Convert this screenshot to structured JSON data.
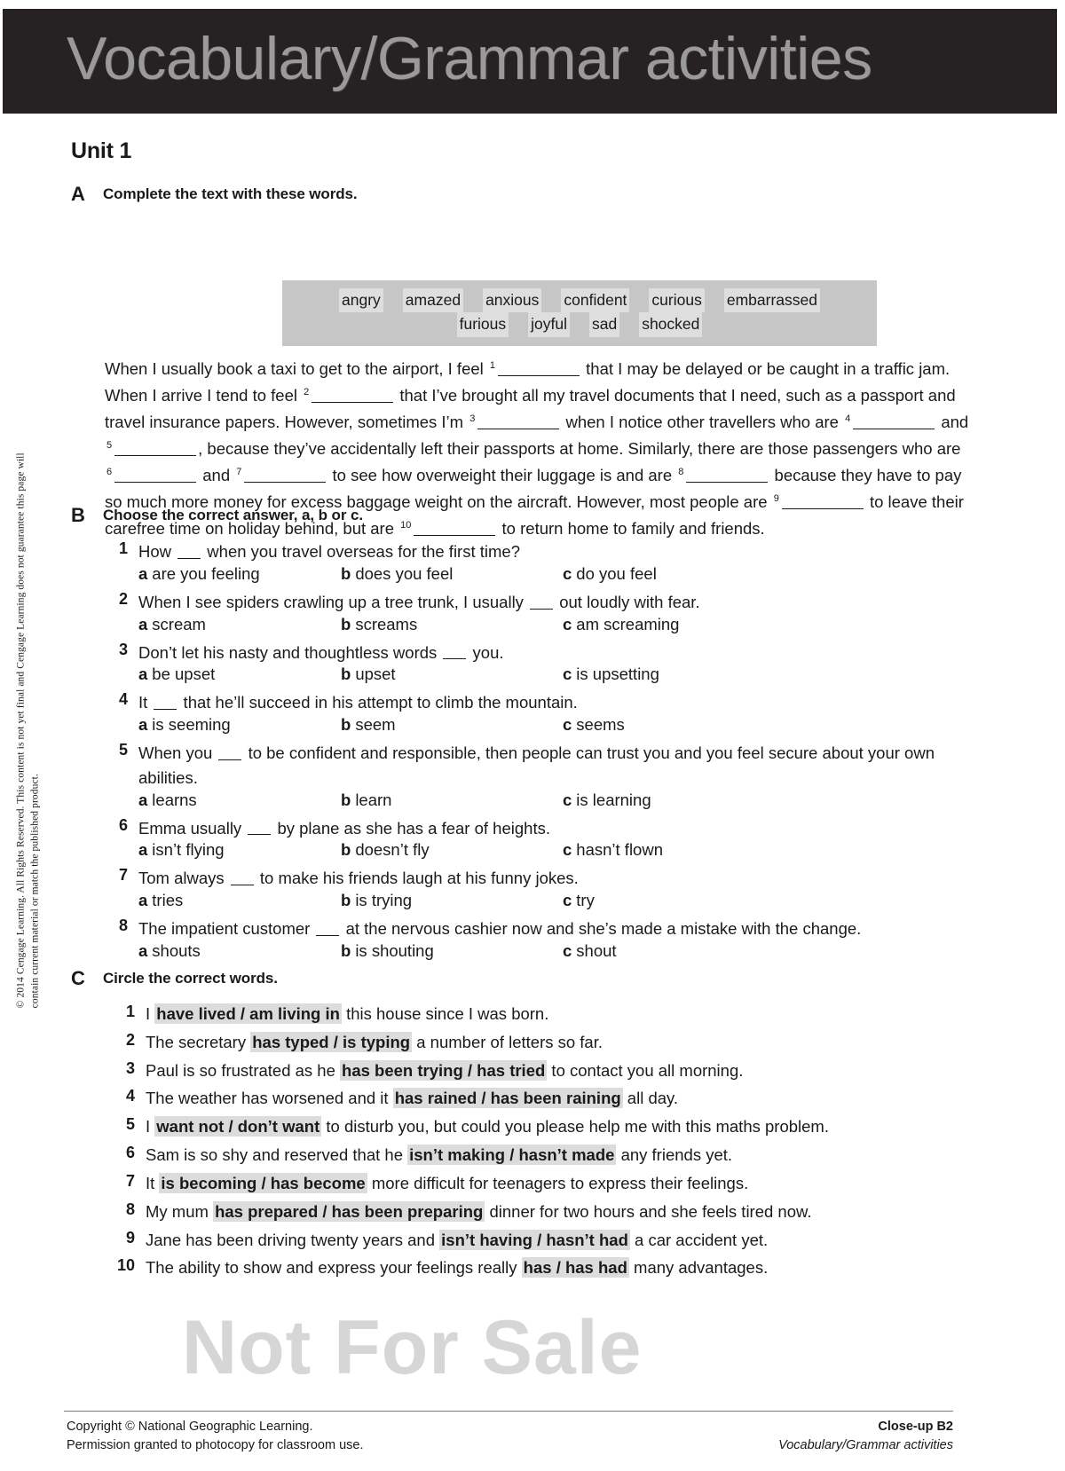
{
  "header": {
    "title": "Vocabulary/Grammar activities",
    "band_color": "#262223",
    "title_color": "#9a9a9a"
  },
  "sidebar": {
    "copyright_note": "© 2014 Cengage Learning. All Rights Reserved. This content is not yet final and Cengage Learning does not guarantee this page will contain current material or match the published product."
  },
  "unit": {
    "title": "Unit 1"
  },
  "exercises": {
    "a": {
      "letter": "A",
      "instruction": "Complete the text with these words.",
      "wordbank": {
        "row1": [
          "angry",
          "amazed",
          "anxious",
          "confident",
          "curious",
          "embarrassed"
        ],
        "row2": [
          "furious",
          "joyful",
          "sad",
          "shocked"
        ],
        "box_color": "#c6c6c6",
        "word_color": "#dedede"
      },
      "text_parts": [
        "When I usually book a taxi to get to the airport, I feel ",
        " that I may be delayed or be caught in a traffic jam. When I arrive I tend to feel ",
        " that I’ve brought all my travel documents that I need, such as a passport and travel insurance papers. However, sometimes I’m ",
        " when I notice other travellers who are ",
        " and ",
        ", because they’ve accidentally left their passports at home. Similarly, there are those passengers who are ",
        " and ",
        " to see how overweight their luggage is and are ",
        " because they have to pay so much more money for excess baggage weight on the aircraft. However, most people are ",
        " to leave their carefree time on holiday behind, but are ",
        " to return home to family and friends."
      ],
      "gap_numbers": [
        "1",
        "2",
        "3",
        "4",
        "5",
        "6",
        "7",
        "8",
        "9",
        "10"
      ]
    },
    "b": {
      "letter": "B",
      "instruction": "Choose the correct answer, a, b or c.",
      "items": [
        {
          "num": "1",
          "stem_before": "How ",
          "stem_after": " when you travel overseas for the first time?",
          "options": [
            {
              "key": "a",
              "text": "are you feeling"
            },
            {
              "key": "b",
              "text": "does you feel"
            },
            {
              "key": "c",
              "text": "do you feel"
            }
          ]
        },
        {
          "num": "2",
          "stem_before": "When I see spiders crawling up a tree trunk, I usually ",
          "stem_after": " out loudly with fear.",
          "options": [
            {
              "key": "a",
              "text": "scream"
            },
            {
              "key": "b",
              "text": "screams"
            },
            {
              "key": "c",
              "text": "am screaming"
            }
          ]
        },
        {
          "num": "3",
          "stem_before": "Don’t let his nasty and thoughtless words ",
          "stem_after": " you.",
          "options": [
            {
              "key": "a",
              "text": "be upset"
            },
            {
              "key": "b",
              "text": "upset"
            },
            {
              "key": "c",
              "text": "is upsetting"
            }
          ]
        },
        {
          "num": "4",
          "stem_before": "It ",
          "stem_after": " that he’ll succeed in his attempt to climb the mountain.",
          "options": [
            {
              "key": "a",
              "text": "is seeming"
            },
            {
              "key": "b",
              "text": "seem"
            },
            {
              "key": "c",
              "text": "seems"
            }
          ]
        },
        {
          "num": "5",
          "stem_before": "When you ",
          "stem_after": " to be confident and responsible, then people can trust you and you feel secure about your own abilities.",
          "options": [
            {
              "key": "a",
              "text": "learns"
            },
            {
              "key": "b",
              "text": "learn"
            },
            {
              "key": "c",
              "text": "is learning"
            }
          ]
        },
        {
          "num": "6",
          "stem_before": "Emma usually ",
          "stem_after": " by plane as she has a fear of heights.",
          "options": [
            {
              "key": "a",
              "text": "isn’t flying"
            },
            {
              "key": "b",
              "text": "doesn’t fly"
            },
            {
              "key": "c",
              "text": "hasn’t flown"
            }
          ]
        },
        {
          "num": "7",
          "stem_before": "Tom always ",
          "stem_after": " to make his friends laugh at his funny jokes.",
          "options": [
            {
              "key": "a",
              "text": "tries"
            },
            {
              "key": "b",
              "text": "is trying"
            },
            {
              "key": "c",
              "text": "try"
            }
          ]
        },
        {
          "num": "8",
          "stem_before": "The impatient customer ",
          "stem_after": " at the nervous cashier now and she’s made a mistake with the change.",
          "options": [
            {
              "key": "a",
              "text": "shouts"
            },
            {
              "key": "b",
              "text": "is shouting"
            },
            {
              "key": "c",
              "text": "shout"
            }
          ]
        }
      ]
    },
    "c": {
      "letter": "C",
      "instruction": "Circle the correct words.",
      "highlight_color": "#dcdcdc",
      "items": [
        {
          "num": "1",
          "before": "I ",
          "choice": "have lived / am living in",
          "after": " this house since I was born."
        },
        {
          "num": "2",
          "before": "The secretary ",
          "choice": "has typed / is typing",
          "after": " a number of letters so far."
        },
        {
          "num": "3",
          "before": "Paul is so frustrated as he ",
          "choice": "has been trying / has tried",
          "after": " to contact you all morning."
        },
        {
          "num": "4",
          "before": "The weather has worsened and it ",
          "choice": "has rained / has been raining",
          "after": " all day."
        },
        {
          "num": "5",
          "before": "I ",
          "choice": "want not / don’t want",
          "after": " to disturb you, but could you please help me with this maths problem."
        },
        {
          "num": "6",
          "before": "Sam is so shy and reserved that he ",
          "choice": "isn’t making / hasn’t made",
          "after": " any friends yet."
        },
        {
          "num": "7",
          "before": "It ",
          "choice": "is becoming / has become",
          "after": " more difficult for teenagers to express their feelings."
        },
        {
          "num": "8",
          "before": "My mum ",
          "choice": "has prepared / has been preparing",
          "after": " dinner for two hours and she feels tired now."
        },
        {
          "num": "9",
          "before": "Jane has been driving twenty years and ",
          "choice": "isn’t having / hasn’t had",
          "after": " a car accident yet."
        },
        {
          "num": "10",
          "before": "The ability to show and express your feelings really ",
          "choice": "has / has had",
          "after": " many advantages."
        }
      ]
    }
  },
  "watermark": {
    "text": "Not For Sale",
    "color": "#d6d6d6"
  },
  "footer": {
    "copyright_line1": "Copyright © National Geographic Learning.",
    "copyright_line2": "Permission granted to photocopy for classroom use.",
    "book": "Close-up B2",
    "section": "Vocabulary/Grammar  activities"
  }
}
